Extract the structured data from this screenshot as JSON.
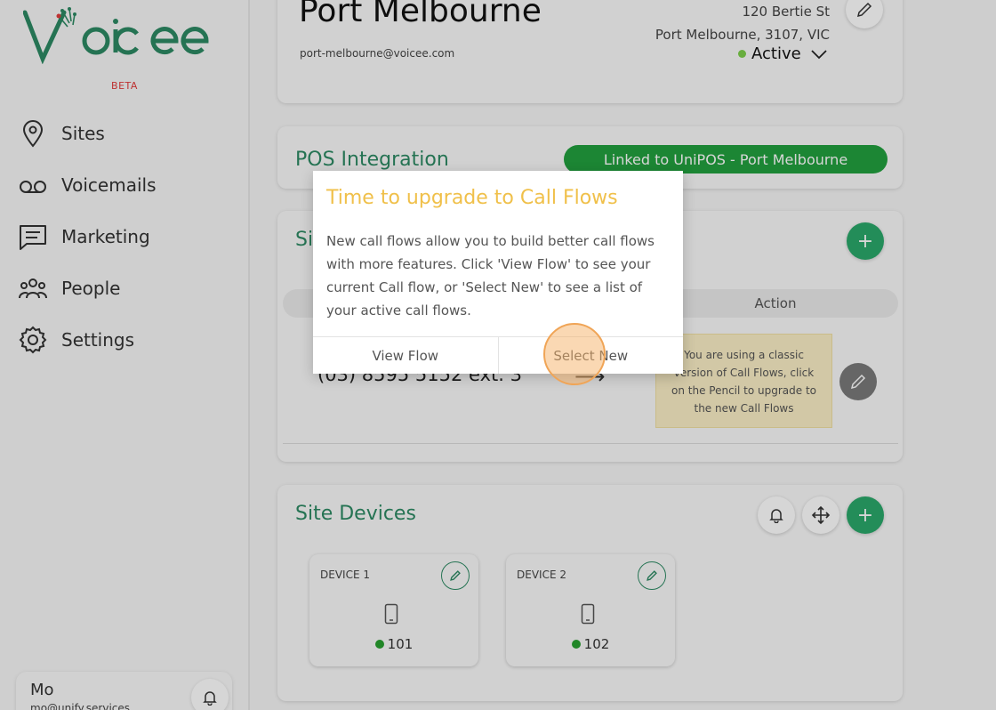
{
  "sidebar": {
    "logo_text": "Voicee",
    "badge": "BETA",
    "items": [
      {
        "label": "Sites",
        "icon": "location-pin-icon"
      },
      {
        "label": "Voicemails",
        "icon": "voicemail-icon"
      },
      {
        "label": "Marketing",
        "icon": "chat-icon"
      },
      {
        "label": "People",
        "icon": "people-icon"
      },
      {
        "label": "Settings",
        "icon": "gear-icon"
      }
    ],
    "user": {
      "name": "Mo",
      "email": "mo@unify.services"
    }
  },
  "site": {
    "name": "Port Melbourne",
    "email": "port-melbourne@voicee.com",
    "address_line1": "120 Bertie St",
    "address_line2": "Port Melbourne, 3107, VIC",
    "status": "Active"
  },
  "pos": {
    "title": "POS Integration",
    "link_label": "Linked to UniPOS - Port Melbourne"
  },
  "site_numbers": {
    "title_partial": "Si",
    "column_action": "Action",
    "phone": "(03) 8595 5152 ext. 3",
    "notice": "You are using a classic version of Call Flows, click on the Pencil to upgrade to the new Call Flows"
  },
  "devices": {
    "title": "Site Devices",
    "items": [
      {
        "label": "DEVICE 1",
        "ext": "101"
      },
      {
        "label": "DEVICE 2",
        "ext": "102"
      }
    ]
  },
  "modal": {
    "title": "Time to upgrade to Call Flows",
    "body": "New call flows allow you to build better call flows with more features. Click 'View Flow' to see your current Call flow, or 'Select New' to see a list of your active call flows.",
    "view_flow": "View Flow",
    "select_new": "Select New"
  },
  "colors": {
    "brand": "#2d8a63",
    "link_green": "#22a03e",
    "modal_title": "#f0c04a",
    "beta": "#e23b3b"
  }
}
